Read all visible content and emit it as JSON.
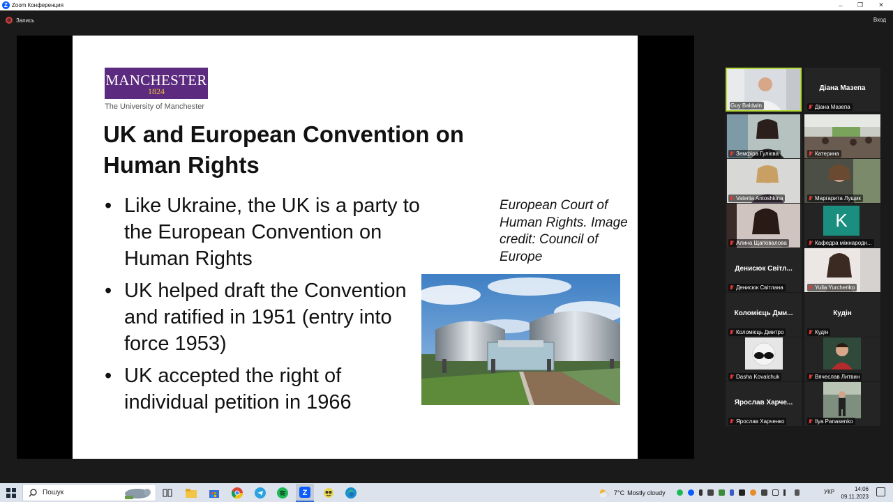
{
  "window": {
    "title": "Zoom Конференция",
    "minimize": "–",
    "restore": "❐",
    "close": "✕"
  },
  "toolbar": {
    "record_label": "Запись",
    "enter_label": "Вход"
  },
  "slide": {
    "logo_name": "MANCHESTER",
    "logo_year": "1824",
    "logo_sub": "The University of Manchester",
    "title": "UK and European Convention on Human Rights",
    "bullets": [
      "Like Ukraine, the UK is a party to the European Convention on Human Rights",
      "UK helped draft the Convention and ratified in 1951 (entry into force 1953)",
      "UK accepted the right of individual petition in 1966"
    ],
    "caption": "European Court of Human Rights. Image credit: Council of Europe",
    "colors": {
      "logo_purple": "#5c2a7e",
      "logo_gold": "#f0c040"
    }
  },
  "participants": [
    {
      "name": "Guy Baldwin",
      "active": true,
      "display": "video"
    },
    {
      "name": "Діана Мазепа",
      "display": "name",
      "big": "Діана Мазепа"
    },
    {
      "name": "Земфіра Гулієва",
      "display": "video"
    },
    {
      "name": "Катерина",
      "display": "video"
    },
    {
      "name": "Valeriia Antoshkina",
      "display": "video"
    },
    {
      "name": "Маргарита Лущик",
      "display": "video"
    },
    {
      "name": "Алина Щаповалова",
      "display": "video"
    },
    {
      "name": "Кафедра міжнародн...",
      "display": "avatar",
      "letter": "K",
      "avatar_color": "#1a8f80"
    },
    {
      "name": "Денисюк Світлана",
      "display": "name",
      "big": "Денисюк Світл..."
    },
    {
      "name": "Yulia Yurchenko",
      "display": "video"
    },
    {
      "name": "Коломієць Дмитро",
      "display": "name",
      "big": "Коломієць Дми..."
    },
    {
      "name": "Кудін",
      "display": "name",
      "big": "Кудін"
    },
    {
      "name": "Dasha Kovalchuk",
      "display": "video"
    },
    {
      "name": "Вячеслав Литвин",
      "display": "video"
    },
    {
      "name": "Ярослав Харченко",
      "display": "name",
      "big": "Ярослав Харче..."
    },
    {
      "name": "Ilya Panasenko",
      "display": "video"
    }
  ],
  "taskbar": {
    "search_placeholder": "Пошук",
    "weather_temp": "7°C",
    "weather_text": "Mostly cloudy",
    "lang": "УКР",
    "time": "14:06",
    "date": "09.11.2023",
    "pinned_apps": [
      "task-view",
      "file-explorer",
      "microsoft-store",
      "chrome",
      "telegram",
      "spotify",
      "zoom",
      "game",
      "edge"
    ]
  }
}
